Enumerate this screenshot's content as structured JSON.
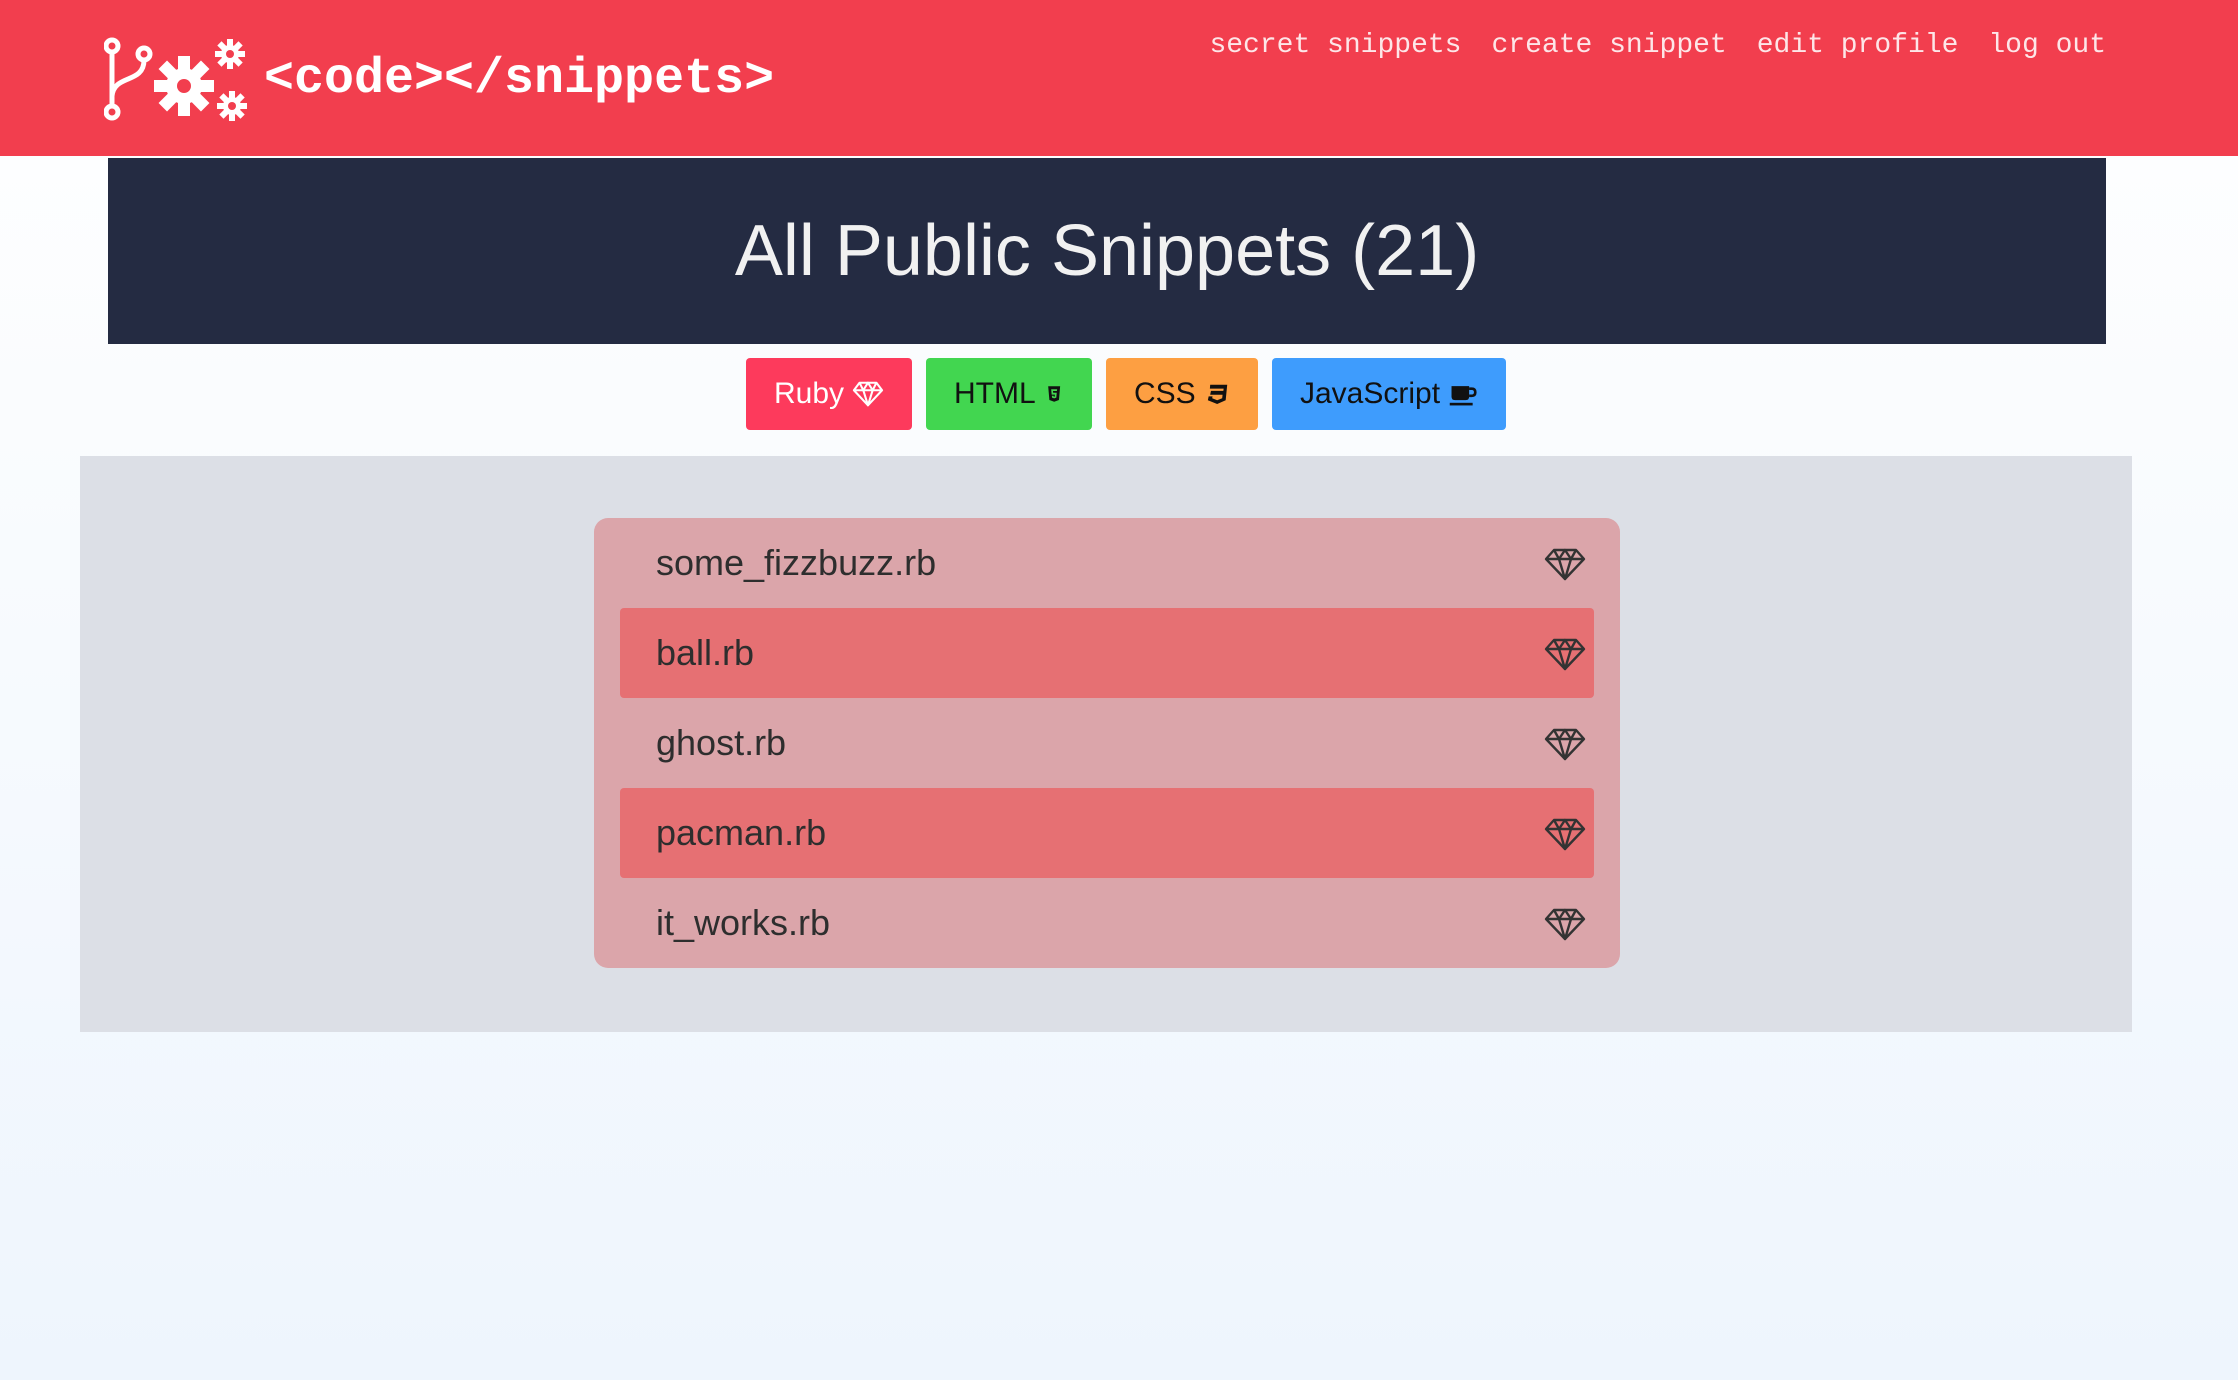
{
  "header": {
    "logo_text": "<code></snippets>",
    "nav": [
      {
        "label": "secret snippets"
      },
      {
        "label": "create snippet"
      },
      {
        "label": "edit profile"
      },
      {
        "label": "log out"
      }
    ]
  },
  "hero": {
    "title": "All Public Snippets (21)"
  },
  "filters": [
    {
      "label": "Ruby",
      "icon": "gem-icon"
    },
    {
      "label": "HTML",
      "icon": "html5-icon"
    },
    {
      "label": "CSS",
      "icon": "css3-icon"
    },
    {
      "label": "JavaScript",
      "icon": "coffee-icon"
    }
  ],
  "snippets": [
    {
      "name": "some_fizzbuzz.rb",
      "icon": "gem-icon"
    },
    {
      "name": "ball.rb",
      "icon": "gem-icon"
    },
    {
      "name": "ghost.rb",
      "icon": "gem-icon"
    },
    {
      "name": "pacman.rb",
      "icon": "gem-icon"
    },
    {
      "name": "it_works.rb",
      "icon": "gem-icon"
    }
  ],
  "colors": {
    "header": "#f23e4e",
    "hero": "#242b42",
    "ruby": "#fd3a5c",
    "html": "#42d650",
    "css": "#fd9f42",
    "javascript": "#3e9cfd",
    "list_bg": "#dba5aa",
    "list_row_alt": "#e67073"
  }
}
